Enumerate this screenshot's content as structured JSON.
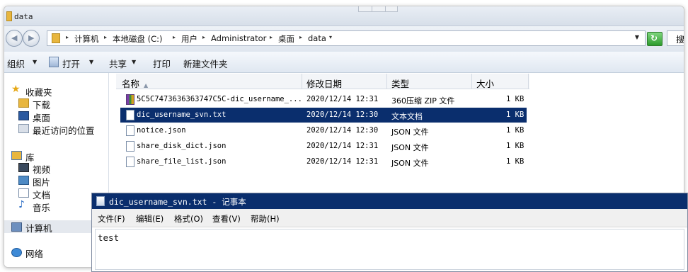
{
  "window": {
    "title": "data"
  },
  "address": {
    "crumbs": [
      "计算机",
      "本地磁盘 (C:)",
      "用户",
      "Administrator",
      "桌面",
      "data"
    ],
    "search_placeholder": "搜"
  },
  "toolbar": {
    "organize": "组织",
    "open": "打开",
    "share": "共享",
    "print": "打印",
    "new_folder": "新建文件夹"
  },
  "nav": {
    "favorites": "收藏夹",
    "downloads": "下载",
    "desktop": "桌面",
    "recent": "最近访问的位置",
    "libraries": "库",
    "videos": "视频",
    "pictures": "图片",
    "documents": "文档",
    "music": "音乐",
    "computer": "计算机",
    "network": "网络"
  },
  "columns": {
    "name": "名称",
    "modified": "修改日期",
    "type": "类型",
    "size": "大小"
  },
  "files": [
    {
      "name": "5C5C7473636363747C5C-dic_username_...",
      "modified": "2020/12/14 12:31",
      "type": "360压缩 ZIP 文件",
      "size": "1 KB",
      "icon": "zip-icon"
    },
    {
      "name": "dic_username_svn.txt",
      "modified": "2020/12/14 12:30",
      "type": "文本文档",
      "size": "1 KB",
      "icon": "text-file-icon",
      "selected": true
    },
    {
      "name": "notice.json",
      "modified": "2020/12/14 12:30",
      "type": "JSON 文件",
      "size": "1 KB",
      "icon": "json-file-icon"
    },
    {
      "name": "share_disk_dict.json",
      "modified": "2020/12/14 12:31",
      "type": "JSON 文件",
      "size": "1 KB",
      "icon": "json-file-icon"
    },
    {
      "name": "share_file_list.json",
      "modified": "2020/12/14 12:31",
      "type": "JSON 文件",
      "size": "1 KB",
      "icon": "json-file-icon"
    }
  ],
  "notepad": {
    "title": "dic_username_svn.txt - 记事本",
    "menu": [
      "文件(F)",
      "编辑(E)",
      "格式(O)",
      "查看(V)",
      "帮助(H)"
    ],
    "content": "test"
  },
  "colors": {
    "selection": "#0a2e6d",
    "folder": "#e8b63e"
  }
}
